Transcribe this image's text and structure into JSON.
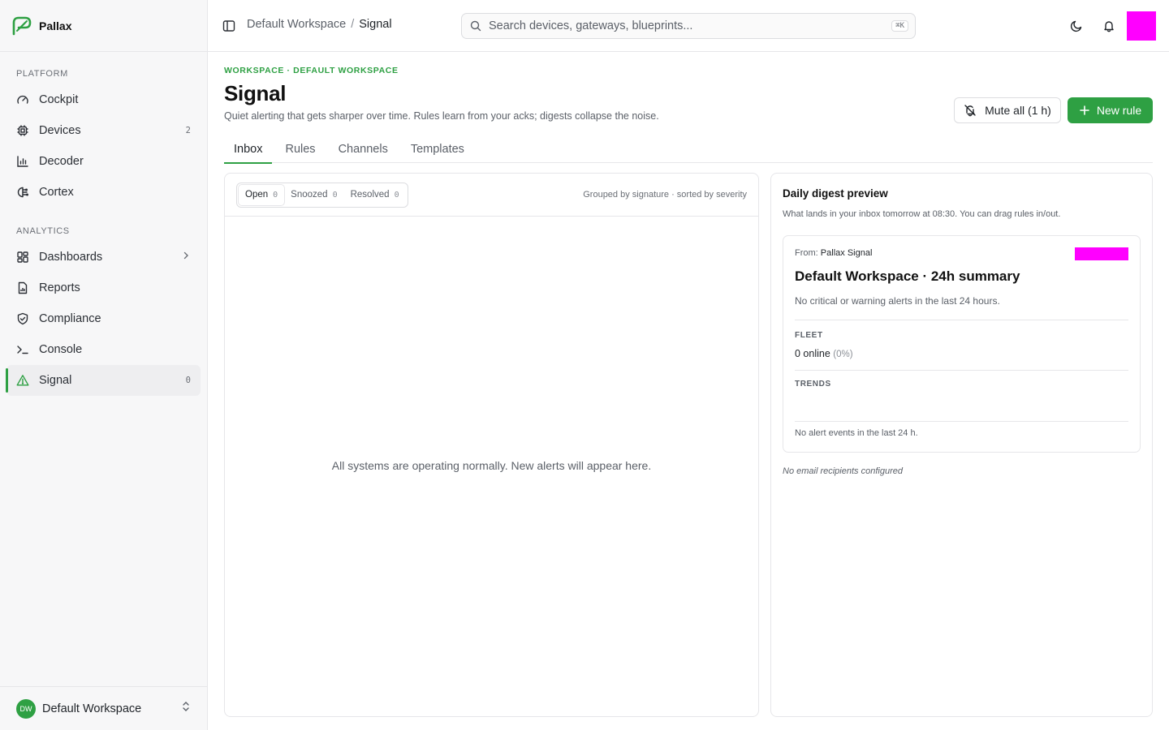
{
  "brand": {
    "name": "Pallax",
    "accent": "#2ea043"
  },
  "sidebar": {
    "sections": [
      {
        "label": "PLATFORM",
        "items": [
          {
            "label": "Cockpit",
            "icon": "gauge-icon"
          },
          {
            "label": "Devices",
            "icon": "chip-icon",
            "count": "2"
          },
          {
            "label": "Decoder",
            "icon": "bar-chart-icon"
          },
          {
            "label": "Cortex",
            "icon": "brain-icon"
          }
        ]
      },
      {
        "label": "ANALYTICS",
        "items": [
          {
            "label": "Dashboards",
            "icon": "grid-icon"
          },
          {
            "label": "Reports",
            "icon": "file-chart-icon"
          },
          {
            "label": "Compliance",
            "icon": "shield-check-icon"
          },
          {
            "label": "Console",
            "icon": "terminal-icon"
          },
          {
            "label": "Signal",
            "icon": "alert-triangle-icon",
            "count": "0",
            "active": true
          }
        ]
      }
    ],
    "workspace": {
      "initials": "DW",
      "name": "Default Workspace"
    }
  },
  "topbar": {
    "breadcrumb": {
      "parent": "Default Workspace",
      "separator": "/",
      "current": "Signal"
    },
    "search": {
      "placeholder": "Search devices, gateways, blueprints...",
      "shortcut": "⌘K"
    }
  },
  "page": {
    "eyebrow": "WORKSPACE · DEFAULT WORKSPACE",
    "title": "Signal",
    "subtitle": "Quiet alerting that gets sharper over time. Rules learn from your acks; digests collapse the noise.",
    "mute_label": "Mute all (1 h)",
    "new_rule_label": "New rule"
  },
  "tabs": [
    {
      "label": "Inbox",
      "active": true
    },
    {
      "label": "Rules"
    },
    {
      "label": "Channels"
    },
    {
      "label": "Templates"
    }
  ],
  "inbox": {
    "segments": [
      {
        "label": "Open",
        "count": "0",
        "active": true
      },
      {
        "label": "Snoozed",
        "count": "0"
      },
      {
        "label": "Resolved",
        "count": "0"
      }
    ],
    "grouping_note": "Grouped by signature · sorted by severity",
    "empty_message": "All systems are operating normally. New alerts will appear here."
  },
  "digest": {
    "title": "Daily digest preview",
    "subtitle": "What lands in your inbox tomorrow at 08:30. You can drag rules in/out.",
    "from_label": "From:",
    "from_sender": "Pallax Signal",
    "subject": "Default Workspace · 24h summary",
    "body": "No critical or warning alerts in the last 24 hours.",
    "fleet_label": "FLEET",
    "fleet_count": "0",
    "fleet_text": " online ",
    "fleet_pct": "(0%)",
    "trends_label": "TRENDS",
    "trends_empty": "No alert events in the last 24 h.",
    "recipients_note": "No email recipients configured"
  }
}
